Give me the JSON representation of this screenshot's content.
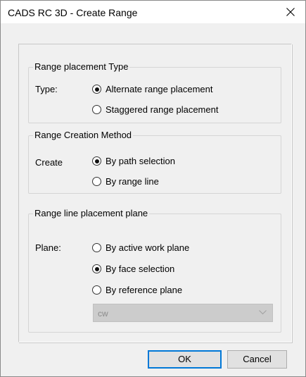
{
  "window": {
    "title": "CADS RC 3D - Create Range",
    "close_glyph": "close-icon"
  },
  "placement_type": {
    "legend": "Range placement Type",
    "label": "Type:",
    "options": [
      {
        "label": "Alternate range placement",
        "checked": true
      },
      {
        "label": "Staggered range placement",
        "checked": false
      }
    ]
  },
  "creation_method": {
    "legend": "Range Creation Method",
    "label": "Create",
    "options": [
      {
        "label": "By path selection",
        "checked": true
      },
      {
        "label": "By range line",
        "checked": false
      }
    ]
  },
  "placement_plane": {
    "legend": "Range line placement plane",
    "label": "Plane:",
    "options": [
      {
        "label": "By active work plane",
        "checked": false
      },
      {
        "label": "By face selection",
        "checked": true
      },
      {
        "label": "By reference plane",
        "checked": false
      }
    ],
    "reference_plane_combo": {
      "value": "cw",
      "enabled": false
    }
  },
  "buttons": {
    "ok": "OK",
    "cancel": "Cancel"
  },
  "colors": {
    "dialog_bg": "#f0f0f0",
    "default_button_border": "#0078d7",
    "disabled_combo_bg": "#cccccc"
  }
}
